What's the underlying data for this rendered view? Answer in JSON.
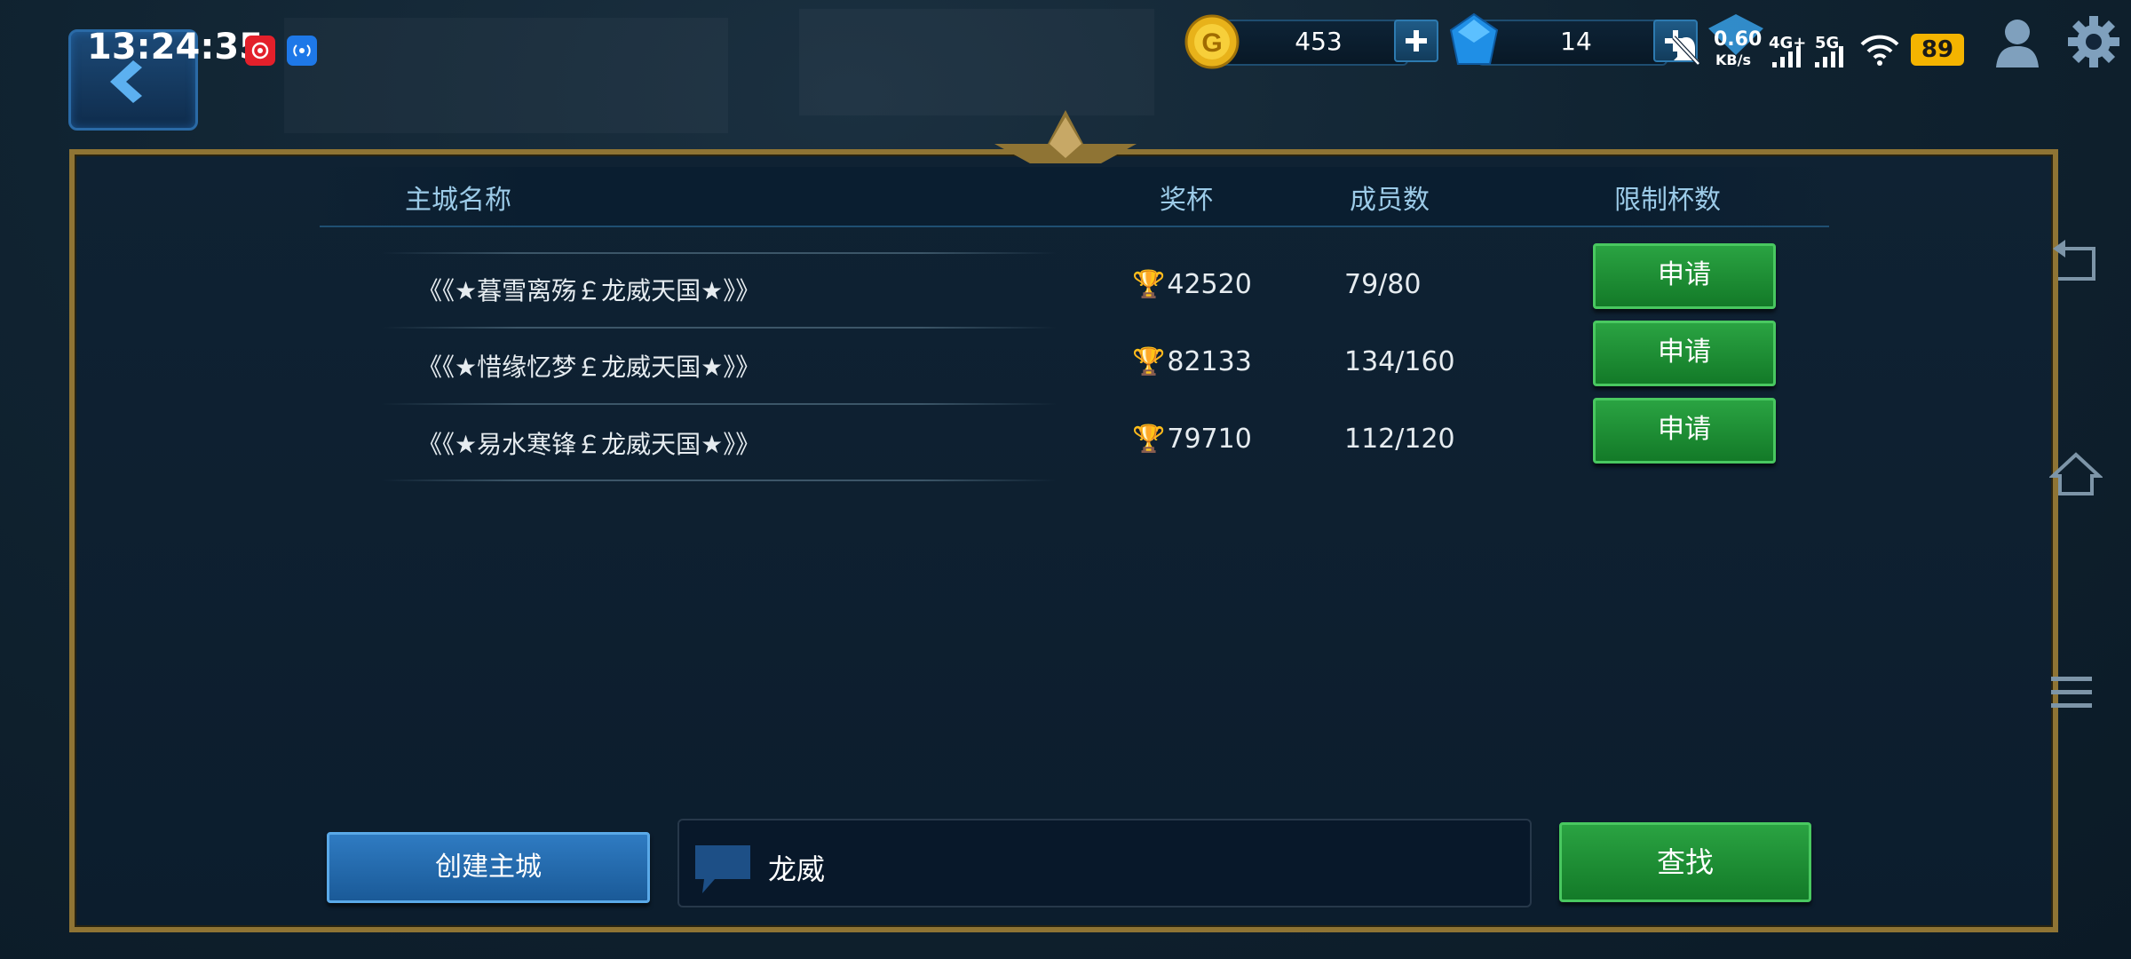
{
  "status_bar": {
    "time": "13:24:35",
    "net_speed": "0.60",
    "net_unit": "KB/s",
    "network_4g": "4G+",
    "network_5g": "5G",
    "battery": "89"
  },
  "currency": {
    "gold": "453",
    "gems": "14"
  },
  "table": {
    "headers": {
      "name": "主城名称",
      "trophy": "奖杯",
      "members": "成员数",
      "limit": "限制杯数"
    },
    "rows": [
      {
        "name": "《《★暮雪离殇￡龙威天国★》》",
        "trophy": "42520",
        "members": "79/80",
        "action": "申请"
      },
      {
        "name": "《《★惜缘忆梦￡龙威天国★》》",
        "trophy": "82133",
        "members": "134/160",
        "action": "申请"
      },
      {
        "name": "《《★易水寒锋￡龙威天国★》》",
        "trophy": "79710",
        "members": "112/120",
        "action": "申请"
      }
    ]
  },
  "footer": {
    "create_label": "创建主城",
    "search_value": "龙威",
    "find_label": "查找"
  },
  "icons": {
    "back": "back-arrow-icon",
    "gold": "gold-coin-icon",
    "gem": "blue-gem-icon",
    "user": "user-icon",
    "settings": "gear-icon",
    "trophy": "trophy-icon",
    "chat": "chat-bubble-icon"
  },
  "colors": {
    "panel_border": "#8f7434",
    "green_button": "#2aa342",
    "blue_button": "#2f7bc2",
    "header_text": "#9ccbe8",
    "battery": "#f4b400"
  }
}
